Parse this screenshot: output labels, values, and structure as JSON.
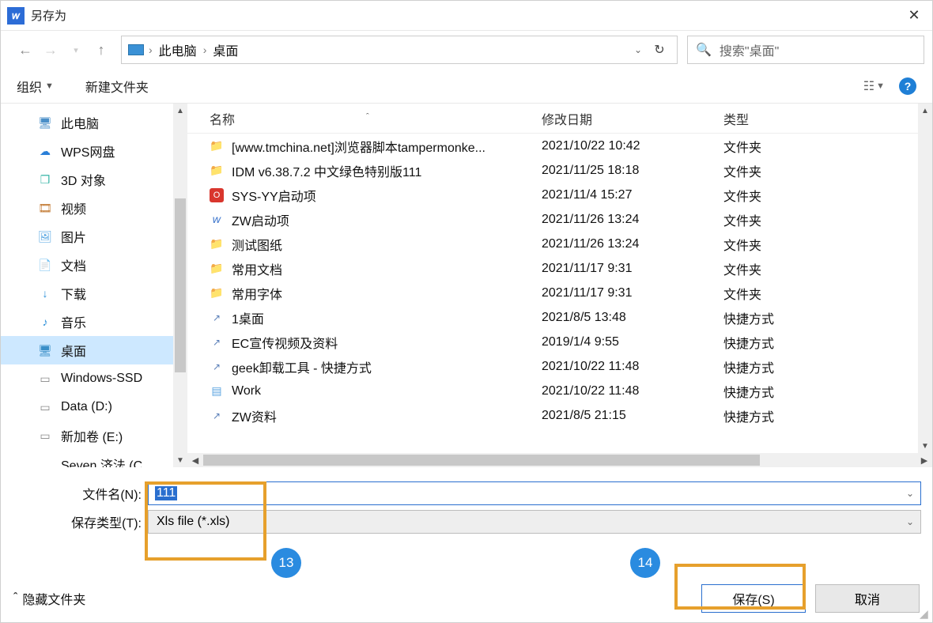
{
  "window": {
    "title": "另存为"
  },
  "nav": {
    "crumb1": "此电脑",
    "crumb2": "桌面"
  },
  "search": {
    "placeholder": "搜索\"桌面\""
  },
  "toolbar": {
    "org": "组织",
    "newfolder": "新建文件夹"
  },
  "columns": {
    "name": "名称",
    "date": "修改日期",
    "type": "类型"
  },
  "sidebar": [
    {
      "label": "此电脑",
      "icon": "pc"
    },
    {
      "label": "WPS网盘",
      "icon": "cloud"
    },
    {
      "label": "3D 对象",
      "icon": "cube"
    },
    {
      "label": "视频",
      "icon": "video"
    },
    {
      "label": "图片",
      "icon": "pic"
    },
    {
      "label": "文档",
      "icon": "doc"
    },
    {
      "label": "下载",
      "icon": "down"
    },
    {
      "label": "音乐",
      "icon": "music"
    },
    {
      "label": "桌面",
      "icon": "desk",
      "selected": true
    },
    {
      "label": "Windows-SSD",
      "icon": "drive"
    },
    {
      "label": "Data (D:)",
      "icon": "drive"
    },
    {
      "label": "新加卷 (E:)",
      "icon": "drive"
    },
    {
      "label": "Seven 济法 (C",
      "icon": "drive_cut"
    }
  ],
  "files": [
    {
      "name": "[www.tmchina.net]浏览器脚本tampermonke...",
      "date": "2021/10/22 10:42",
      "type": "文件夹",
      "icon": "folder"
    },
    {
      "name": "IDM v6.38.7.2  中文绿色特别版111",
      "date": "2021/11/25 18:18",
      "type": "文件夹",
      "icon": "folder"
    },
    {
      "name": "SYS-YY启动项",
      "date": "2021/11/4 15:27",
      "type": "文件夹",
      "icon": "red"
    },
    {
      "name": "ZW启动项",
      "date": "2021/11/26 13:24",
      "type": "文件夹",
      "icon": "app"
    },
    {
      "name": "测试图纸",
      "date": "2021/11/26 13:24",
      "type": "文件夹",
      "icon": "folder"
    },
    {
      "name": "常用文档",
      "date": "2021/11/17 9:31",
      "type": "文件夹",
      "icon": "folder"
    },
    {
      "name": "常用字体",
      "date": "2021/11/17 9:31",
      "type": "文件夹",
      "icon": "folder"
    },
    {
      "name": "1桌面",
      "date": "2021/8/5 13:48",
      "type": "快捷方式",
      "icon": "link"
    },
    {
      "name": "EC宣传视频及资料",
      "date": "2019/1/4 9:55",
      "type": "快捷方式",
      "icon": "link"
    },
    {
      "name": "geek卸载工具 - 快捷方式",
      "date": "2021/10/22 11:48",
      "type": "快捷方式",
      "icon": "link"
    },
    {
      "name": "Work",
      "date": "2021/10/22 11:48",
      "type": "快捷方式",
      "icon": "file"
    },
    {
      "name": "ZW资料",
      "date": "2021/8/5 21:15",
      "type": "快捷方式",
      "icon": "link"
    }
  ],
  "form": {
    "filename_label": "文件名(N):",
    "filename_value": "111",
    "type_label": "保存类型(T):",
    "type_value": "Xls file (*.xls)"
  },
  "footer": {
    "hide": "隐藏文件夹",
    "save": "保存(S)",
    "cancel": "取消"
  },
  "callouts": {
    "c13": "13",
    "c14": "14"
  }
}
